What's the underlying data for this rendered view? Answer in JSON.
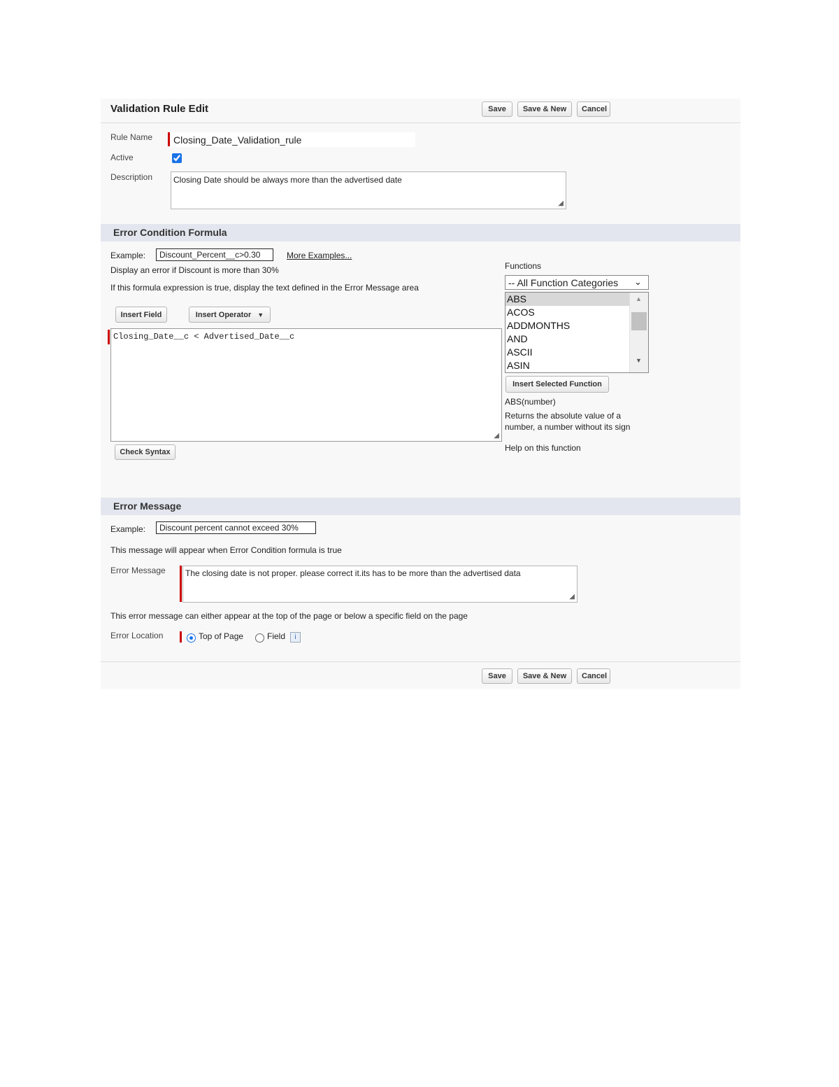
{
  "header": {
    "title": "Validation Rule Edit",
    "save": "Save",
    "save_new": "Save & New",
    "cancel": "Cancel"
  },
  "rule": {
    "name_label": "Rule Name",
    "name_value": "Closing_Date_Validation_rule",
    "active_label": "Active",
    "active_checked": true,
    "description_label": "Description",
    "description_value": "Closing Date should be always more than the advertised date"
  },
  "formula_section": {
    "title": "Error Condition Formula",
    "example_label": "Example:",
    "example_value": "Discount_Percent__c>0.30",
    "more_examples": "More Examples...",
    "hint1": "Display an error if Discount is more than 30%",
    "hint2": "If this formula expression is true, display the text defined in the Error Message area",
    "insert_field": "Insert Field",
    "insert_operator": "Insert Operator",
    "formula_value": "Closing_Date__c <  Advertised_Date__c",
    "check_syntax": "Check Syntax"
  },
  "functions": {
    "label": "Functions",
    "category_selected": "-- All Function Categories",
    "items": [
      "ABS",
      "ACOS",
      "ADDMONTHS",
      "AND",
      "ASCII",
      "ASIN"
    ],
    "selected": "ABS",
    "insert_selected": "Insert Selected Function",
    "signature": "ABS(number)",
    "description": "Returns the absolute value of a number, a number without its sign",
    "help_link": "Help on this function"
  },
  "error_section": {
    "title": "Error Message",
    "example_label": "Example:",
    "example_value": "Discount percent cannot exceed 30%",
    "hint1": "This message will appear when Error Condition formula is true",
    "message_label": "Error Message",
    "message_value": "The closing date is not proper. please correct it.its has to be more than the advertised data",
    "hint2": "This error message can either appear at the top of the page or below a specific field on the page",
    "location_label": "Error Location",
    "location_top": "Top of Page",
    "location_field": "Field",
    "location_selected": "Top of Page"
  },
  "footer": {
    "save": "Save",
    "save_new": "Save & New",
    "cancel": "Cancel"
  },
  "colors": {
    "section_bg": "#e3e6ee",
    "panel_bg": "#f8f8f8",
    "required": "#cc0000",
    "accent": "#1a73e8"
  }
}
